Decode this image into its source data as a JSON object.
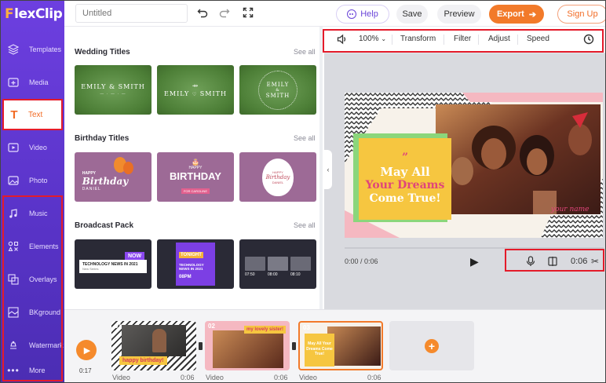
{
  "app": {
    "logo_first": "F",
    "logo_rest": "lexClip"
  },
  "sidebar": {
    "items": [
      {
        "label": "Templates",
        "icon": "layers-icon"
      },
      {
        "label": "Media",
        "icon": "media-icon"
      },
      {
        "label": "Text",
        "icon": "text-icon"
      },
      {
        "label": "Video",
        "icon": "video-icon"
      },
      {
        "label": "Photo",
        "icon": "photo-icon"
      },
      {
        "label": "Music",
        "icon": "music-icon"
      },
      {
        "label": "Elements",
        "icon": "elements-icon"
      },
      {
        "label": "Overlays",
        "icon": "overlays-icon"
      },
      {
        "label": "BKground",
        "icon": "background-icon"
      },
      {
        "label": "Watermark",
        "icon": "watermark-icon"
      },
      {
        "label": "More",
        "icon": "more-icon"
      }
    ]
  },
  "topbar": {
    "title_placeholder": "Untitled",
    "help": "Help",
    "save": "Save",
    "preview": "Preview",
    "export": "Export",
    "signup": "Sign Up"
  },
  "library": {
    "see_all": "See all",
    "sections": [
      {
        "title": "Wedding Titles",
        "thumbs": [
          {
            "line1": "EMILY & SMITH",
            "line2": ""
          },
          {
            "line1": "EMILY",
            "line2": "SMITH"
          },
          {
            "line1": "EMILY",
            "line2": "SMITH"
          }
        ]
      },
      {
        "title": "Birthday Titles",
        "thumbs": [
          {
            "line1": "HAPPY",
            "line2": "Birthday",
            "line3": "DANIEL"
          },
          {
            "line1": "HAPPY",
            "line2": "BIRTHDAY",
            "line3": "FOR CAROLINE"
          },
          {
            "line1": "HAPPY",
            "line2": "Birthday",
            "line3": "DANIEL"
          }
        ]
      },
      {
        "title": "Broadcast Pack",
        "thumbs": [
          {
            "badge": "NOW",
            "line1": "TECHNOLOGY NEWS IN 2021",
            "line2": "New Series"
          },
          {
            "badge": "TONIGHT",
            "line1": "TECHNOLOGY NEWS IN 2021",
            "line2": "08PM"
          },
          {
            "line1": "07:50",
            "line2": "08:00",
            "line3": "08:10"
          }
        ]
      }
    ]
  },
  "preview": {
    "volume_icon": "volume-icon",
    "zoom": "100%",
    "transform": "Transform",
    "filter": "Filter",
    "adjust": "Adjust",
    "speed": "Speed",
    "duration_icon": "clock-icon",
    "quote_mark": "”",
    "quote_line1": "May All",
    "quote_line2": "Your Dreams",
    "quote_line3": "Come True!",
    "name_tag": "your name",
    "timecode": "0:00 / 0:06",
    "clip_duration": "0:06"
  },
  "timeline": {
    "total_time": "0:17",
    "clips": [
      {
        "num": "01",
        "type": "Video",
        "duration": "0:06",
        "caption": "happy birthday!"
      },
      {
        "num": "02",
        "type": "Video",
        "duration": "0:06",
        "caption": "my lovely sister!"
      },
      {
        "num": "03",
        "type": "Video",
        "duration": "0:06",
        "caption": "May All Your Dreams Come True!"
      }
    ]
  },
  "colors": {
    "brand_purple": "#6d3fe0",
    "accent_orange": "#f27a2a",
    "highlight_red": "#e41b2a"
  }
}
